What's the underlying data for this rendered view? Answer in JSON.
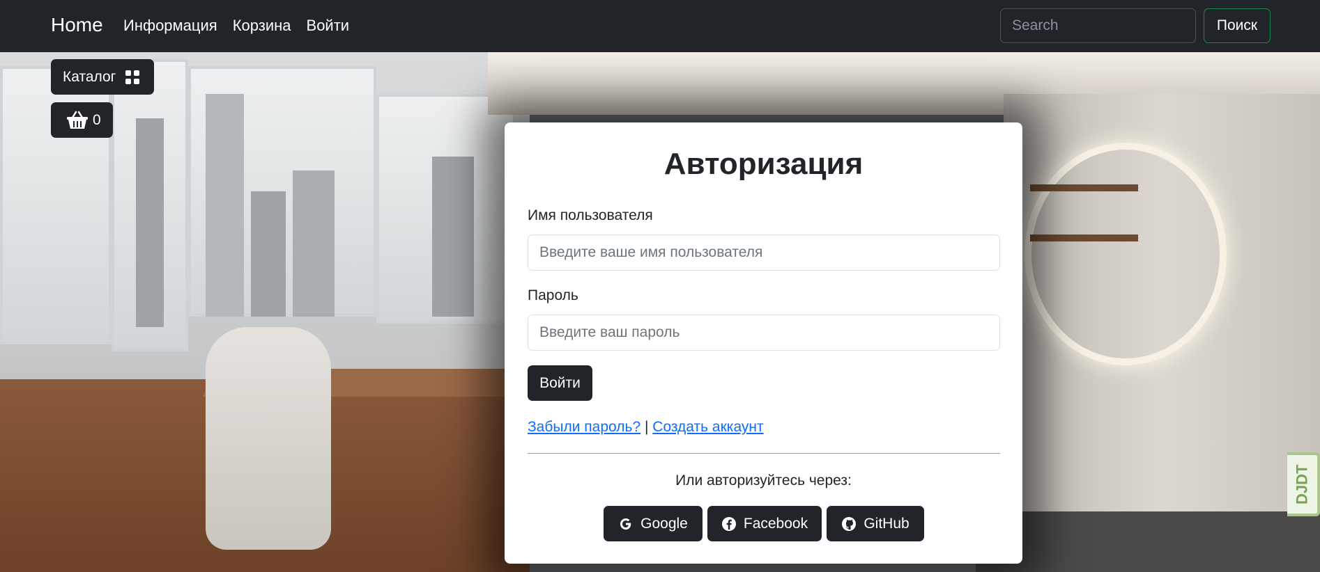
{
  "navbar": {
    "brand": "Home",
    "links": [
      "Информация",
      "Корзина",
      "Войти"
    ],
    "search_placeholder": "Search",
    "search_button": "Поиск"
  },
  "sidebar_buttons": {
    "catalog_label": "Каталог",
    "catalog_icon": "grid-icon",
    "cart_icon": "basket-icon",
    "cart_count": "0"
  },
  "login_card": {
    "title": "Авторизация",
    "username_label": "Имя пользователя",
    "username_placeholder": "Введите ваше имя пользователя",
    "password_label": "Пароль",
    "password_placeholder": "Введите ваш пароль",
    "submit_label": "Войти",
    "forgot_link": "Забыли пароль?",
    "separator": "|",
    "register_link": "Создать аккаунт",
    "or_text": "Или авторизуйтесь через:",
    "social": [
      {
        "label": "Google",
        "icon": "google-icon"
      },
      {
        "label": "Facebook",
        "icon": "facebook-icon"
      },
      {
        "label": "GitHub",
        "icon": "github-icon"
      }
    ]
  },
  "debug_toolbar": {
    "label": "DJDT"
  },
  "colors": {
    "navbar_bg": "#212529",
    "button_dark": "#212529",
    "link_blue": "#0d6efd",
    "search_outline": "#198754"
  }
}
